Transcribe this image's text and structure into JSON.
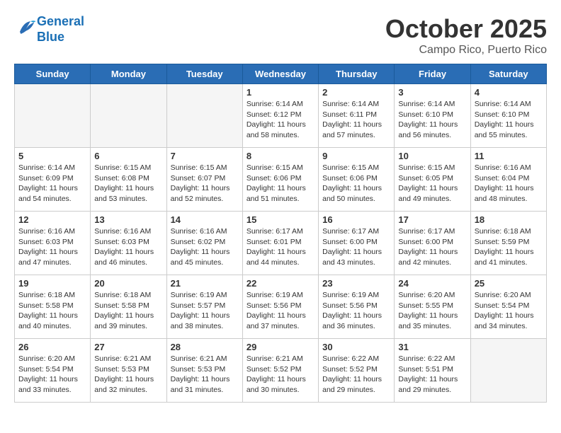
{
  "header": {
    "logo_line1": "General",
    "logo_line2": "Blue",
    "month_title": "October 2025",
    "subtitle": "Campo Rico, Puerto Rico"
  },
  "weekdays": [
    "Sunday",
    "Monday",
    "Tuesday",
    "Wednesday",
    "Thursday",
    "Friday",
    "Saturday"
  ],
  "weeks": [
    [
      {
        "day": "",
        "info": ""
      },
      {
        "day": "",
        "info": ""
      },
      {
        "day": "",
        "info": ""
      },
      {
        "day": "1",
        "info": "Sunrise: 6:14 AM\nSunset: 6:12 PM\nDaylight: 11 hours\nand 58 minutes."
      },
      {
        "day": "2",
        "info": "Sunrise: 6:14 AM\nSunset: 6:11 PM\nDaylight: 11 hours\nand 57 minutes."
      },
      {
        "day": "3",
        "info": "Sunrise: 6:14 AM\nSunset: 6:10 PM\nDaylight: 11 hours\nand 56 minutes."
      },
      {
        "day": "4",
        "info": "Sunrise: 6:14 AM\nSunset: 6:10 PM\nDaylight: 11 hours\nand 55 minutes."
      }
    ],
    [
      {
        "day": "5",
        "info": "Sunrise: 6:14 AM\nSunset: 6:09 PM\nDaylight: 11 hours\nand 54 minutes."
      },
      {
        "day": "6",
        "info": "Sunrise: 6:15 AM\nSunset: 6:08 PM\nDaylight: 11 hours\nand 53 minutes."
      },
      {
        "day": "7",
        "info": "Sunrise: 6:15 AM\nSunset: 6:07 PM\nDaylight: 11 hours\nand 52 minutes."
      },
      {
        "day": "8",
        "info": "Sunrise: 6:15 AM\nSunset: 6:06 PM\nDaylight: 11 hours\nand 51 minutes."
      },
      {
        "day": "9",
        "info": "Sunrise: 6:15 AM\nSunset: 6:06 PM\nDaylight: 11 hours\nand 50 minutes."
      },
      {
        "day": "10",
        "info": "Sunrise: 6:15 AM\nSunset: 6:05 PM\nDaylight: 11 hours\nand 49 minutes."
      },
      {
        "day": "11",
        "info": "Sunrise: 6:16 AM\nSunset: 6:04 PM\nDaylight: 11 hours\nand 48 minutes."
      }
    ],
    [
      {
        "day": "12",
        "info": "Sunrise: 6:16 AM\nSunset: 6:03 PM\nDaylight: 11 hours\nand 47 minutes."
      },
      {
        "day": "13",
        "info": "Sunrise: 6:16 AM\nSunset: 6:03 PM\nDaylight: 11 hours\nand 46 minutes."
      },
      {
        "day": "14",
        "info": "Sunrise: 6:16 AM\nSunset: 6:02 PM\nDaylight: 11 hours\nand 45 minutes."
      },
      {
        "day": "15",
        "info": "Sunrise: 6:17 AM\nSunset: 6:01 PM\nDaylight: 11 hours\nand 44 minutes."
      },
      {
        "day": "16",
        "info": "Sunrise: 6:17 AM\nSunset: 6:00 PM\nDaylight: 11 hours\nand 43 minutes."
      },
      {
        "day": "17",
        "info": "Sunrise: 6:17 AM\nSunset: 6:00 PM\nDaylight: 11 hours\nand 42 minutes."
      },
      {
        "day": "18",
        "info": "Sunrise: 6:18 AM\nSunset: 5:59 PM\nDaylight: 11 hours\nand 41 minutes."
      }
    ],
    [
      {
        "day": "19",
        "info": "Sunrise: 6:18 AM\nSunset: 5:58 PM\nDaylight: 11 hours\nand 40 minutes."
      },
      {
        "day": "20",
        "info": "Sunrise: 6:18 AM\nSunset: 5:58 PM\nDaylight: 11 hours\nand 39 minutes."
      },
      {
        "day": "21",
        "info": "Sunrise: 6:19 AM\nSunset: 5:57 PM\nDaylight: 11 hours\nand 38 minutes."
      },
      {
        "day": "22",
        "info": "Sunrise: 6:19 AM\nSunset: 5:56 PM\nDaylight: 11 hours\nand 37 minutes."
      },
      {
        "day": "23",
        "info": "Sunrise: 6:19 AM\nSunset: 5:56 PM\nDaylight: 11 hours\nand 36 minutes."
      },
      {
        "day": "24",
        "info": "Sunrise: 6:20 AM\nSunset: 5:55 PM\nDaylight: 11 hours\nand 35 minutes."
      },
      {
        "day": "25",
        "info": "Sunrise: 6:20 AM\nSunset: 5:54 PM\nDaylight: 11 hours\nand 34 minutes."
      }
    ],
    [
      {
        "day": "26",
        "info": "Sunrise: 6:20 AM\nSunset: 5:54 PM\nDaylight: 11 hours\nand 33 minutes."
      },
      {
        "day": "27",
        "info": "Sunrise: 6:21 AM\nSunset: 5:53 PM\nDaylight: 11 hours\nand 32 minutes."
      },
      {
        "day": "28",
        "info": "Sunrise: 6:21 AM\nSunset: 5:53 PM\nDaylight: 11 hours\nand 31 minutes."
      },
      {
        "day": "29",
        "info": "Sunrise: 6:21 AM\nSunset: 5:52 PM\nDaylight: 11 hours\nand 30 minutes."
      },
      {
        "day": "30",
        "info": "Sunrise: 6:22 AM\nSunset: 5:52 PM\nDaylight: 11 hours\nand 29 minutes."
      },
      {
        "day": "31",
        "info": "Sunrise: 6:22 AM\nSunset: 5:51 PM\nDaylight: 11 hours\nand 29 minutes."
      },
      {
        "day": "",
        "info": ""
      }
    ]
  ]
}
